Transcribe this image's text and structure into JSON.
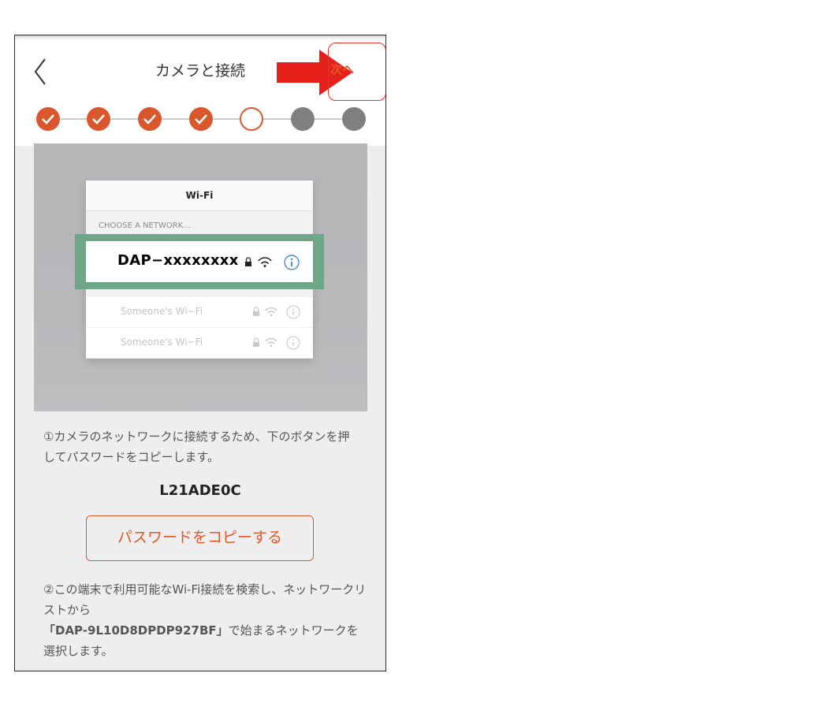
{
  "header": {
    "title": "カメラと接続",
    "next_label": "次へ",
    "accent": "#e0582a",
    "annotation_color": "#e6332a"
  },
  "steps": {
    "completed": 4,
    "current": 5,
    "total": 7
  },
  "illustration": {
    "wifi_title": "Wi-Fi",
    "choose_label": "CHOOSE A NETWORK...",
    "highlight_network": "DAP−xxxxxxxx",
    "other_networks": [
      "Someone's Wi−Fi",
      "Someone's Wi−Fi"
    ]
  },
  "instructions": {
    "step1": "①カメラのネットワークに接続するため、下のボタンを押してパスワードをコピーします。",
    "password": "L21ADE0C",
    "copy_button": "パスワードをコピーする",
    "step2_pre": "②この端末で利用可能なWi-Fi接続を検索し、ネットワークリストから",
    "step2_network": "「DAP-9L10D8DPDP927BF」",
    "step2_post": "で始まるネットワークを選択します。"
  }
}
